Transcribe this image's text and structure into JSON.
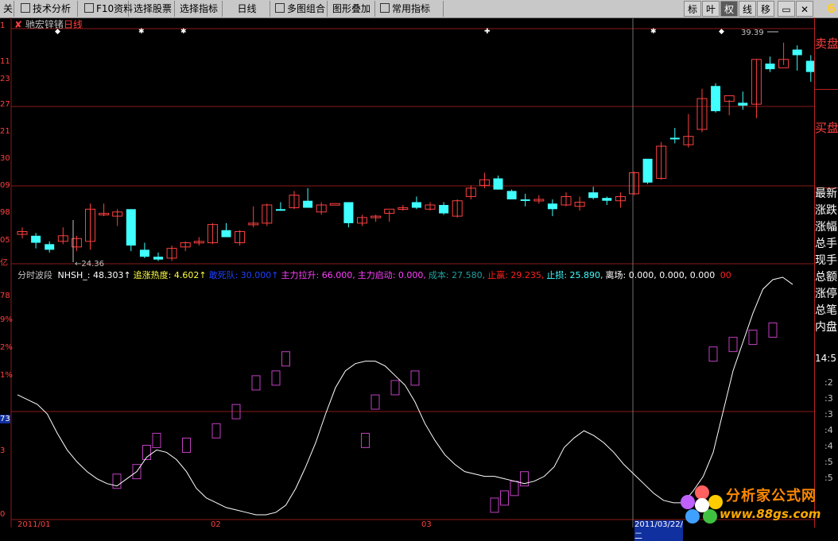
{
  "toolbar": {
    "first": "关",
    "items": [
      "技术分析",
      "F10资料",
      "选择股票",
      "选择指标",
      "日线",
      "多图组合",
      "图形叠加",
      "常用指标"
    ],
    "right": [
      "标",
      "叶",
      "权",
      "线",
      "移"
    ],
    "active_right": "权",
    "corner_number": "6"
  },
  "stock": {
    "name": "驰宏锌锗",
    "period": "日线"
  },
  "price_chart": {
    "annotation_low": "←24.36",
    "annotation_high": "39.39"
  },
  "left_axis_labels": [
    "1",
    "11",
    "23",
    "27",
    "21",
    "30",
    "09",
    "98",
    "05",
    "亿",
    "78",
    "9%",
    "2%",
    "1%",
    "73",
    "3",
    "0"
  ],
  "indicator": {
    "name": "分时波段",
    "items": [
      {
        "label": "NHSH_:",
        "value": "48.303",
        "arrow": "↑",
        "color": "#ffffff"
      },
      {
        "label": "追涨热度:",
        "value": "4.602",
        "arrow": "↑",
        "color": "#ffff40"
      },
      {
        "label": "敢死队:",
        "value": "30.000",
        "arrow": "↑",
        "color": "#2040ff"
      },
      {
        "label": "主力拉升:",
        "value": "66.000,",
        "arrow": "",
        "color": "#ff40ff"
      },
      {
        "label": "主力启动:",
        "value": "0.000,",
        "arrow": "",
        "color": "#ff40ff"
      },
      {
        "label": "成本:",
        "value": "27.580,",
        "arrow": "",
        "color": "#20a0a0"
      },
      {
        "label": "止赢:",
        "value": "29.235,",
        "arrow": "",
        "color": "#ff2020"
      },
      {
        "label": "止损:",
        "value": "25.890,",
        "arrow": "",
        "color": "#40ffff"
      },
      {
        "label": "离场:",
        "value": "0.000, 0.000, 0.000",
        "arrow": "",
        "color": "#ffffff"
      },
      {
        "label": "",
        "value": "00",
        "arrow": "",
        "color": "#ff2020"
      }
    ]
  },
  "right_panel": {
    "sell": "卖盘",
    "buy": "买盘",
    "list": [
      "最新",
      "涨跌",
      "涨幅",
      "总手",
      "现手",
      "总额",
      "涨停",
      "总笔",
      "内盘"
    ],
    "time": "14:5",
    "ticks": [
      ":2",
      ":3",
      ":3",
      ":4",
      ":4",
      ":5",
      ":5"
    ]
  },
  "date_axis": [
    "2011/01",
    "02",
    "03",
    "2011/03/22/二"
  ],
  "watermark": {
    "title": "分析家公式网",
    "url": "www.88gs.com"
  },
  "colors": {
    "up": "#ff4040",
    "down": "#40ffff",
    "grid": "#8b1a1a",
    "curve": "#ffffff",
    "box": "#c040c0"
  },
  "candles": [
    [
      25.1,
      25.6,
      24.8,
      25.3
    ],
    [
      25.0,
      25.2,
      24.1,
      24.5
    ],
    [
      24.4,
      24.6,
      23.8,
      24.0
    ],
    [
      24.6,
      25.6,
      24.4,
      25.0
    ],
    [
      24.2,
      25.0,
      23.9,
      24.8
    ],
    [
      24.6,
      27.3,
      24.0,
      26.9
    ],
    [
      26.5,
      27.3,
      26.4,
      26.6
    ],
    [
      26.4,
      26.9,
      25.7,
      26.7
    ],
    [
      26.9,
      26.9,
      23.9,
      24.3
    ],
    [
      24.0,
      24.5,
      23.4,
      23.5
    ],
    [
      23.5,
      23.8,
      23.2,
      23.3
    ],
    [
      23.4,
      24.3,
      23.2,
      24.1
    ],
    [
      24.2,
      24.6,
      23.9,
      24.5
    ],
    [
      24.6,
      24.9,
      24.3,
      24.6
    ],
    [
      24.5,
      25.9,
      24.4,
      25.8
    ],
    [
      25.4,
      25.9,
      24.9,
      24.9
    ],
    [
      24.5,
      25.4,
      24.3,
      25.3
    ],
    [
      25.8,
      27.1,
      25.6,
      25.9
    ],
    [
      25.9,
      27.3,
      25.7,
      27.2
    ],
    [
      26.9,
      27.4,
      26.8,
      26.8
    ],
    [
      27.0,
      28.2,
      26.9,
      27.9
    ],
    [
      27.5,
      28.4,
      27.0,
      27.0
    ],
    [
      26.7,
      27.4,
      26.5,
      27.2
    ],
    [
      27.3,
      27.3,
      27.3,
      27.3
    ],
    [
      27.4,
      27.4,
      25.6,
      25.9
    ],
    [
      25.9,
      26.5,
      25.7,
      26.3
    ],
    [
      26.3,
      26.5,
      26.0,
      26.4
    ],
    [
      26.6,
      26.8,
      26.0,
      26.9
    ],
    [
      26.9,
      27.2,
      26.8,
      27.0
    ],
    [
      27.4,
      27.8,
      26.9,
      27.0
    ],
    [
      26.9,
      27.4,
      26.8,
      27.2
    ],
    [
      27.2,
      27.4,
      26.5,
      26.6
    ],
    [
      26.4,
      27.6,
      26.3,
      27.5
    ],
    [
      27.8,
      28.6,
      27.6,
      28.4
    ],
    [
      28.6,
      29.5,
      28.4,
      29.0
    ],
    [
      29.1,
      29.3,
      28.3,
      28.3
    ],
    [
      28.2,
      28.3,
      27.6,
      27.6
    ],
    [
      27.6,
      28.0,
      27.1,
      27.5
    ],
    [
      27.5,
      27.9,
      27.3,
      27.6
    ],
    [
      27.3,
      27.6,
      26.4,
      26.9
    ],
    [
      27.2,
      28.1,
      27.1,
      27.8
    ],
    [
      27.1,
      27.8,
      26.8,
      27.4
    ],
    [
      28.1,
      28.5,
      27.6,
      27.7
    ],
    [
      27.7,
      27.8,
      27.2,
      27.5
    ],
    [
      27.5,
      28.1,
      27.0,
      27.8
    ],
    [
      28.0,
      29.6,
      27.9,
      29.5
    ],
    [
      30.5,
      30.5,
      28.7,
      28.8
    ],
    [
      29.1,
      31.7,
      29.0,
      31.4
    ],
    [
      32.0,
      32.7,
      31.6,
      31.9
    ],
    [
      31.5,
      33.7,
      31.3,
      32.1
    ],
    [
      32.6,
      35.5,
      32.4,
      34.8
    ],
    [
      35.7,
      35.9,
      33.8,
      33.9
    ],
    [
      34.6,
      34.7,
      33.6,
      35.0
    ],
    [
      34.5,
      35.3,
      34.0,
      34.3
    ],
    [
      34.4,
      37.6,
      33.4,
      37.6
    ],
    [
      37.3,
      37.8,
      36.7,
      36.9
    ],
    [
      37.0,
      38.8,
      37.2,
      37.6
    ]
  ],
  "wave_boxes": [
    [
      10,
      13
    ],
    [
      12,
      17
    ],
    [
      13,
      25
    ],
    [
      14,
      30
    ],
    [
      17,
      28
    ],
    [
      20,
      34
    ],
    [
      22,
      42
    ],
    [
      24,
      54
    ],
    [
      26,
      56
    ],
    [
      27,
      64
    ],
    [
      35,
      30
    ],
    [
      36,
      46
    ],
    [
      38,
      52
    ],
    [
      40,
      56
    ],
    [
      48,
      3
    ],
    [
      49,
      6
    ],
    [
      50,
      10
    ],
    [
      51,
      14
    ],
    [
      70,
      66
    ],
    [
      72,
      70
    ],
    [
      74,
      73
    ],
    [
      76,
      76
    ]
  ],
  "wave_curve": [
    [
      0,
      52
    ],
    [
      2,
      48
    ],
    [
      3,
      44
    ],
    [
      4,
      36
    ],
    [
      5,
      29
    ],
    [
      6,
      24
    ],
    [
      7,
      20
    ],
    [
      8,
      17
    ],
    [
      9,
      15
    ],
    [
      10,
      14
    ],
    [
      11,
      17
    ],
    [
      12,
      20
    ],
    [
      13,
      26
    ],
    [
      14,
      29
    ],
    [
      15,
      28
    ],
    [
      16,
      25
    ],
    [
      17,
      20
    ],
    [
      18,
      13
    ],
    [
      19,
      9
    ],
    [
      20,
      7
    ],
    [
      21,
      5
    ],
    [
      22,
      4
    ],
    [
      23,
      3
    ],
    [
      24,
      2
    ],
    [
      25,
      2
    ],
    [
      26,
      3
    ],
    [
      27,
      6
    ],
    [
      28,
      13
    ],
    [
      29,
      22
    ],
    [
      30,
      32
    ],
    [
      31,
      44
    ],
    [
      32,
      55
    ],
    [
      33,
      62
    ],
    [
      34,
      65
    ],
    [
      35,
      66
    ],
    [
      36,
      66
    ],
    [
      37,
      64
    ],
    [
      38,
      60
    ],
    [
      39,
      56
    ],
    [
      40,
      49
    ],
    [
      41,
      40
    ],
    [
      42,
      33
    ],
    [
      43,
      27
    ],
    [
      44,
      23
    ],
    [
      45,
      20
    ],
    [
      46,
      19
    ],
    [
      47,
      18
    ],
    [
      48,
      18
    ],
    [
      49,
      17
    ],
    [
      50,
      16
    ],
    [
      51,
      15
    ],
    [
      52,
      16
    ],
    [
      53,
      18
    ],
    [
      54,
      22
    ],
    [
      55,
      30
    ],
    [
      56,
      34
    ],
    [
      57,
      37
    ],
    [
      58,
      35
    ],
    [
      59,
      32
    ],
    [
      60,
      28
    ],
    [
      61,
      23
    ],
    [
      62,
      19
    ],
    [
      63,
      15
    ],
    [
      64,
      11
    ],
    [
      65,
      8
    ],
    [
      66,
      7
    ],
    [
      67,
      7
    ],
    [
      68,
      12
    ],
    [
      69,
      18
    ],
    [
      70,
      28
    ],
    [
      71,
      45
    ],
    [
      72,
      62
    ],
    [
      73,
      74
    ],
    [
      74,
      86
    ],
    [
      75,
      96
    ],
    [
      76,
      100
    ],
    [
      77,
      101
    ],
    [
      78,
      98
    ]
  ]
}
